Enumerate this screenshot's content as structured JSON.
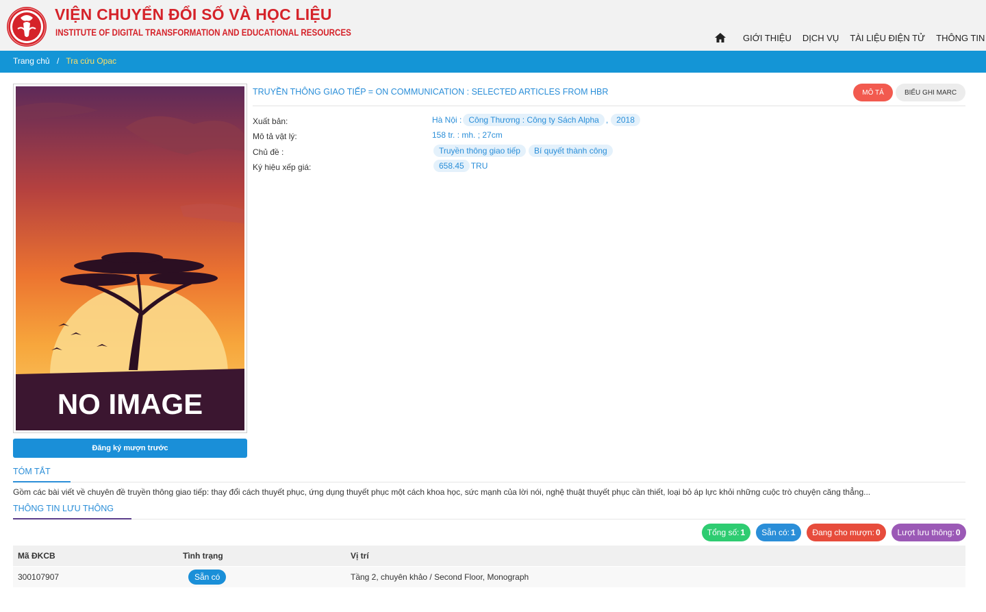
{
  "header": {
    "title": "VIỆN CHUYỂN ĐỔI SỐ VÀ HỌC LIỆU",
    "subtitle": "INSTITUTE OF DIGITAL TRANSFORMATION AND EDUCATIONAL RESOURCES",
    "nav": [
      "GIỚI THIỆU",
      "DỊCH VỤ",
      "TÀI LIỆU ĐIỆN TỬ",
      "THÔNG TIN BẠ"
    ]
  },
  "breadcrumb": {
    "home": "Trang chủ",
    "separator": "/",
    "current": "Tra cứu Opac"
  },
  "cover": {
    "placeholder_text": "NO IMAGE"
  },
  "reserve_button": "Đăng ký mượn trước",
  "record": {
    "title": "TRUYỀN THÔNG GIAO TIẾP = ON COMMUNICATION : SELECTED ARTICLES FROM HBR",
    "tabs": {
      "description": "MÔ TẢ",
      "marc": "BIỂU GHI MARC"
    },
    "publication": {
      "label": "Xuất bản:",
      "place": "Hà Nội :",
      "publisher": "Công Thương : Công ty Sách Alpha",
      "comma": ",",
      "year": "2018"
    },
    "physical": {
      "label": "Mô tả vật lý:",
      "value": "158 tr. : mh. ; 27cm"
    },
    "subject": {
      "label": "Chủ đề :",
      "values": [
        "Truyền thông giao tiếp",
        "Bí quyết thành công"
      ]
    },
    "call_number": {
      "label": "Ký hiệu xếp giá:",
      "class": "658.45",
      "cutter": "TRU"
    }
  },
  "summary": {
    "heading": "TÓM TẮT",
    "text": "Gồm các bài viết về chuyên đề truyền thông giao tiếp: thay đổi cách thuyết phục, ứng dụng thuyết phục một cách khoa học, sức mạnh của lời nói, nghệ thuật thuyết phục cần thiết, loại bỏ áp lực khỏi những cuộc trò chuyện căng thẳng..."
  },
  "circulation": {
    "heading": "THÔNG TIN LƯU THÔNG",
    "stats": [
      {
        "label": "Tổng số:",
        "value": "1",
        "color": "#2ecc71"
      },
      {
        "label": "Sẵn có:",
        "value": "1",
        "color": "#2a8ed8"
      },
      {
        "label": "Đang cho mượn:",
        "value": "0",
        "color": "#e74c3c"
      },
      {
        "label": "Lượt lưu thông:",
        "value": "0",
        "color": "#9b59b6"
      }
    ],
    "columns": [
      "Mã ĐKCB",
      "Tình trạng",
      "Vị trí"
    ],
    "rows": [
      {
        "code": "300107907",
        "status": "Sẵn có",
        "location": "Tầng 2, chuyên khảo / Second Floor, Monograph"
      }
    ]
  },
  "colors": {
    "brand_red": "#d5232a",
    "accent_blue": "#1495d6",
    "link_blue": "#2a8ed8",
    "active_tab": "#f25a4f",
    "underline_purple": "#5b3d8a"
  }
}
